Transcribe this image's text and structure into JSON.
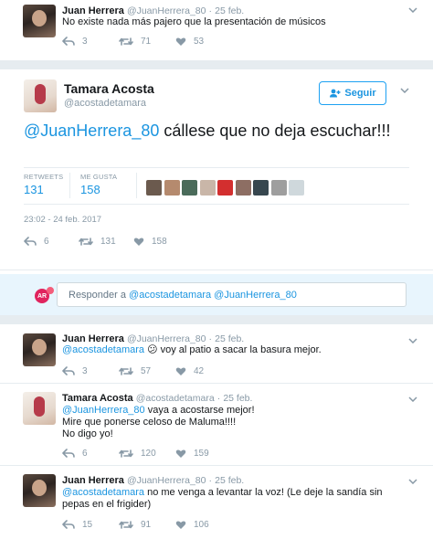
{
  "top_tweet": {
    "name": "Juan Herrera",
    "handle": "@JuanHerrera_80",
    "dot": "·",
    "time": "25 feb.",
    "text": "No existe nada más pajero que la presentación de músicos",
    "replies": "3",
    "retweets": "71",
    "likes": "53"
  },
  "main_tweet": {
    "name": "Tamara Acosta",
    "handle": "@acostadetamara",
    "follow_label": "Seguir",
    "mention": "@JuanHerrera_80",
    "text": " cállese que no deja escuchar!!!",
    "stats": {
      "retweets_label": "RETWEETS",
      "retweets": "131",
      "likes_label": "ME GUSTA",
      "likes": "158"
    },
    "timestamp": "23:02 - 24 feb. 2017",
    "actions": {
      "replies": "6",
      "retweets": "131",
      "likes": "158"
    },
    "likers_colors": [
      "#6b5a4e",
      "#b58a6e",
      "#4a6b5a",
      "#c9b6a8",
      "#d32f2f",
      "#8d6e63",
      "#37474f",
      "#9e9e9e",
      "#cfd8dc"
    ]
  },
  "reply_box": {
    "avatar_text": "AR",
    "prefix": "Responder a ",
    "mention1": "@acostadetamara",
    "mention2": "@JuanHerrera_80"
  },
  "replies": [
    {
      "name": "Juan Herrera",
      "handle": "@JuanHerrera_80",
      "dot": "·",
      "time": "25 feb.",
      "mention": "@acostadetamara",
      "emoji": "😕",
      "text": " voy al patio a sacar la basura mejor.",
      "replies": "3",
      "retweets": "57",
      "likes": "42"
    },
    {
      "name": "Tamara Acosta",
      "handle": "@acostadetamara",
      "dot": "·",
      "time": "25 feb.",
      "mention": "@JuanHerrera_80",
      "line1": " vaya a acostarse mejor!",
      "line2": "Mire que ponerse celoso de Maluma!!!!",
      "line3": "No digo yo!",
      "replies": "6",
      "retweets": "120",
      "likes": "159"
    },
    {
      "name": "Juan Herrera",
      "handle": "@JuanHerrera_80",
      "dot": "·",
      "time": "25 feb.",
      "mention": "@acostadetamara",
      "line1": " no me venga a levantar la voz! (Le deje la sandía sin",
      "line2": "pepas en el frigider)",
      "replies": "15",
      "retweets": "91",
      "likes": "106"
    }
  ]
}
